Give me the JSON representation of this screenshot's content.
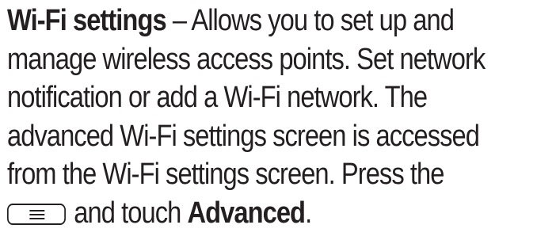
{
  "paragraph": {
    "term": "Wi-Fi settings",
    "line1_rest": " – Allows you to set up and",
    "line2": "manage wireless access points. Set network",
    "line3": "notification or add a Wi-Fi network. The",
    "line4": "advanced Wi-Fi settings screen is accessed",
    "line5": "from the Wi-Fi settings screen. Press the",
    "line6_mid": "and touch ",
    "line6_bold": "Advanced",
    "line6_end": "."
  },
  "icons": {
    "menu_key": "menu-key-icon"
  }
}
